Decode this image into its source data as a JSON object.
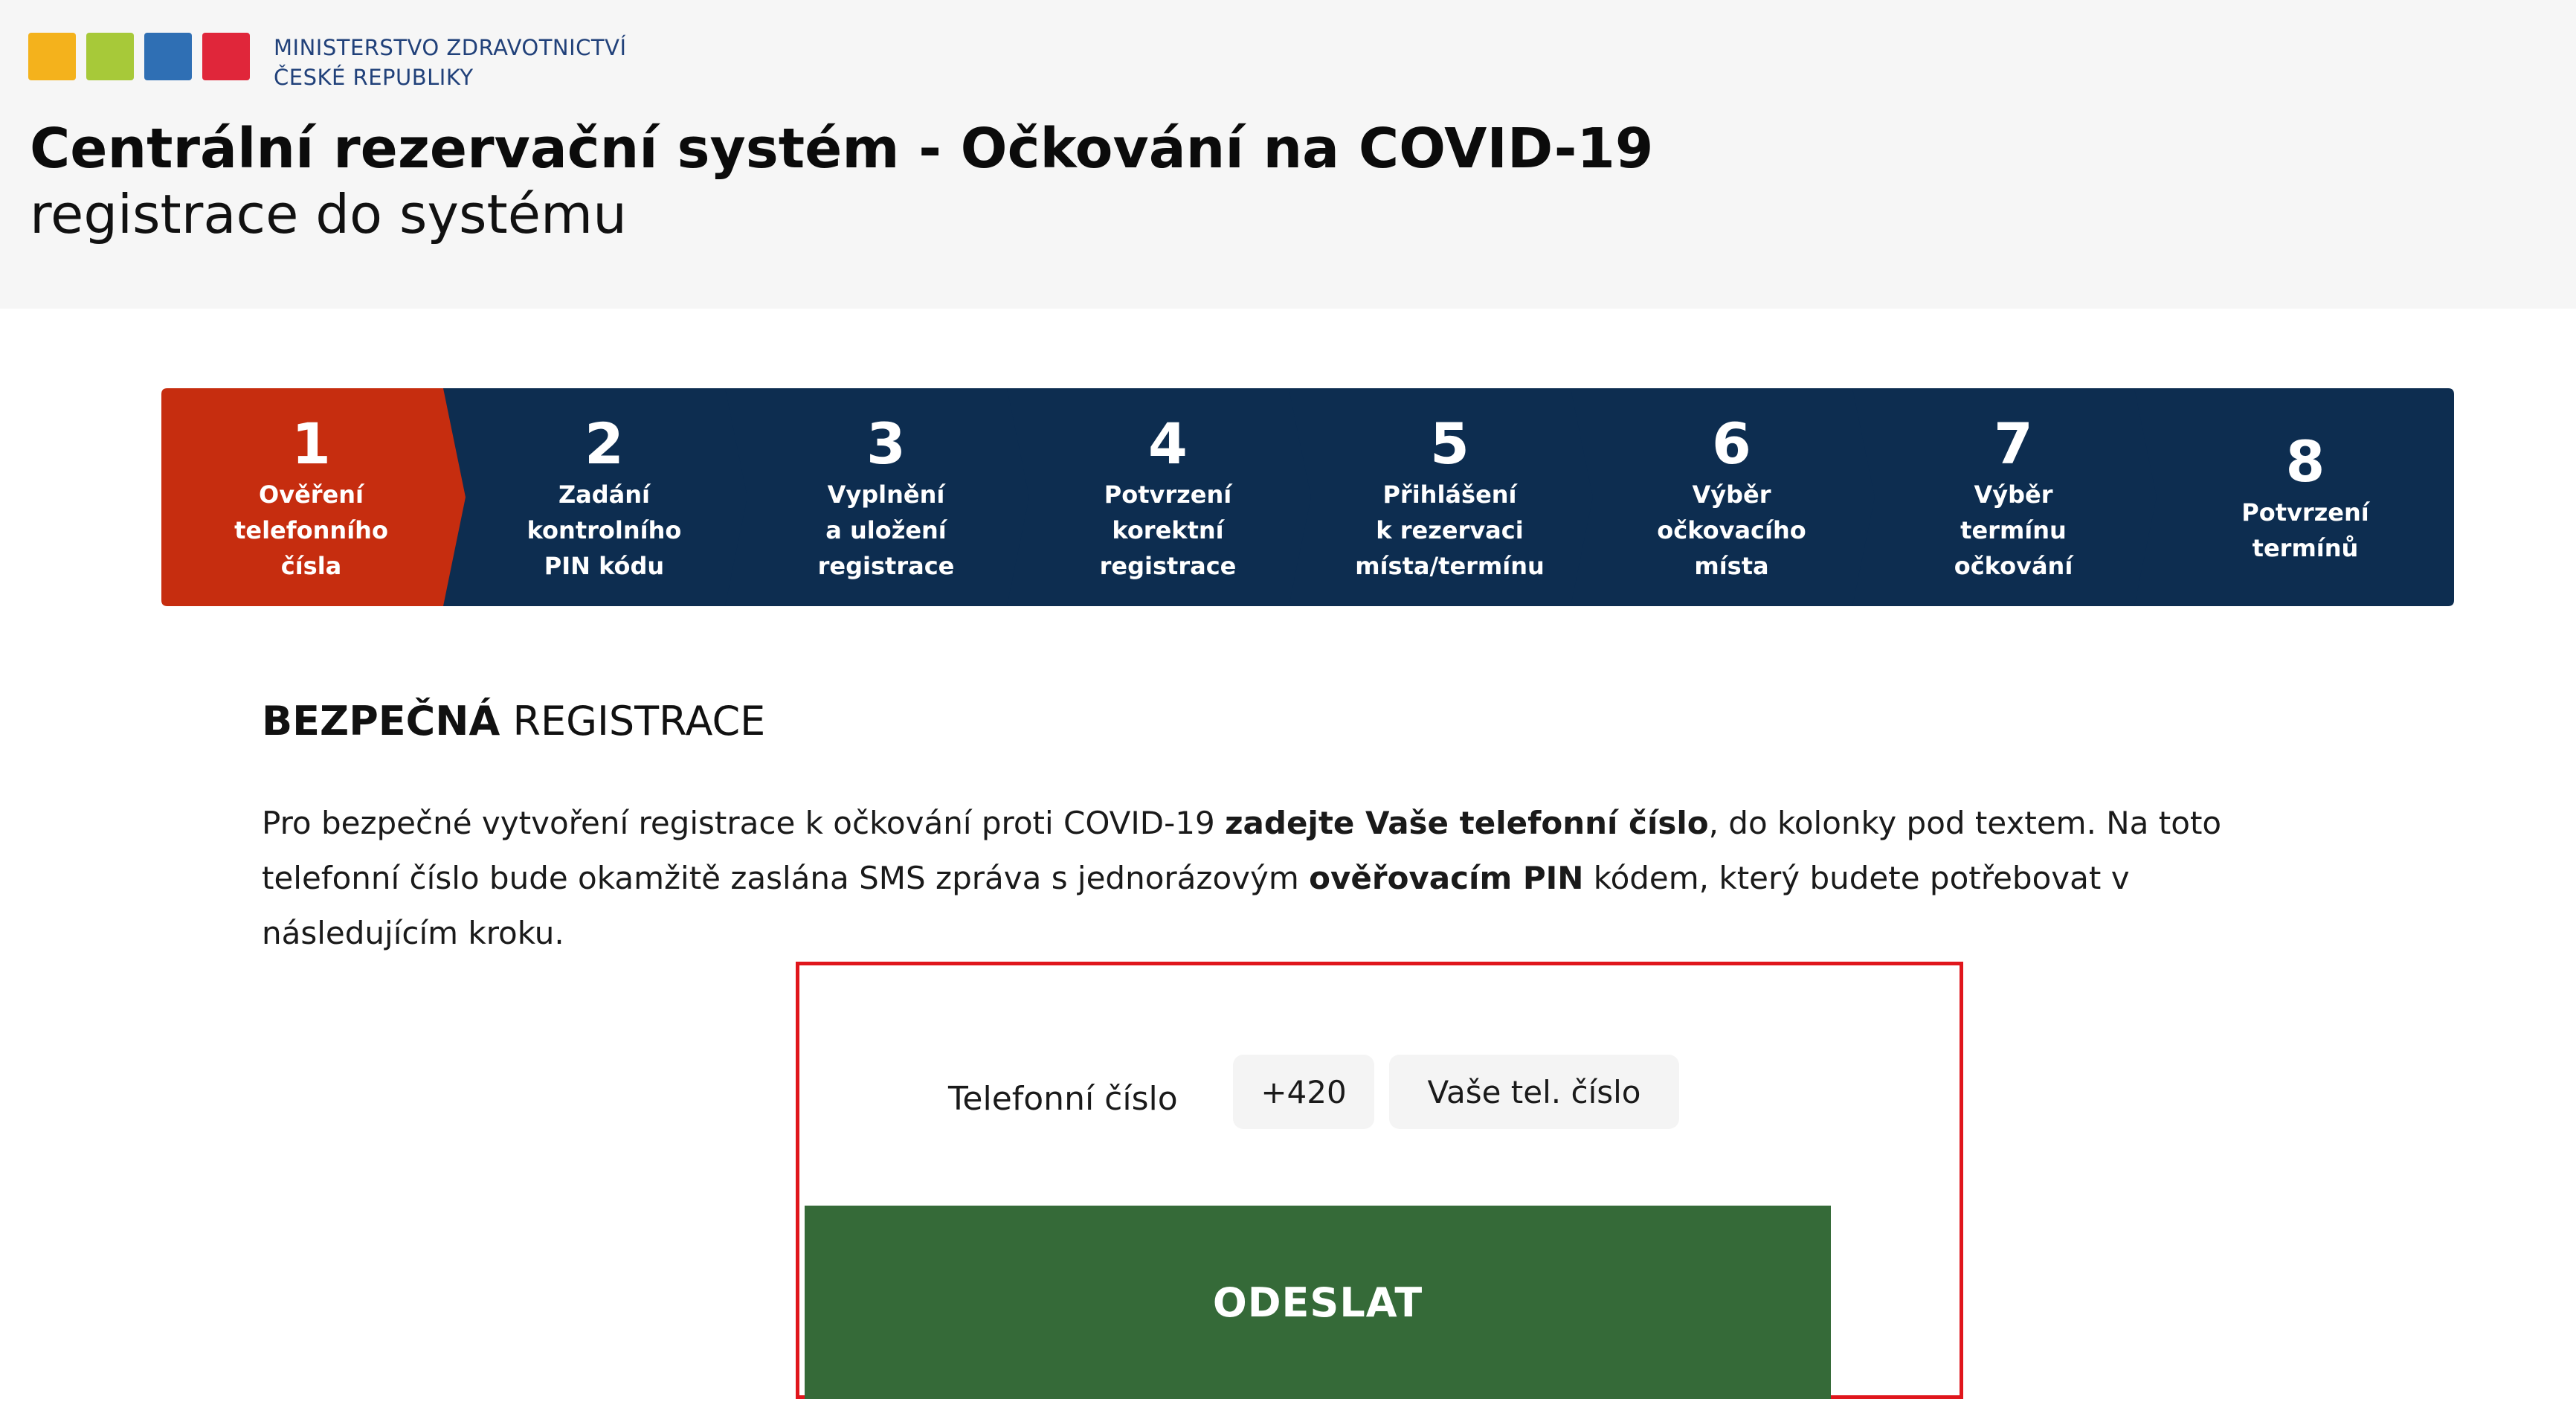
{
  "header": {
    "ministry_line1": "MINISTERSTVO ZDRAVOTNICTVÍ",
    "ministry_line2": "ČESKÉ REPUBLIKY",
    "title": "Centrální rezervační systém - Očkování na COVID-19",
    "subtitle": "registrace do systému"
  },
  "logo": {
    "tile_colors": [
      "#f4b21c",
      "#a7c939",
      "#2f6fb4",
      "#e0263a"
    ]
  },
  "stepper": {
    "active_color": "#c62d0f",
    "inactive_color": "#0d2d50",
    "active_step": 1,
    "steps": [
      {
        "num": "1",
        "label": "Ověření\ntelefonního\nčísla"
      },
      {
        "num": "2",
        "label": "Zadání\nkontrolního\nPIN kódu"
      },
      {
        "num": "3",
        "label": "Vyplnění\na uložení\nregistrace"
      },
      {
        "num": "4",
        "label": "Potvrzení\nkorektní\nregistrace"
      },
      {
        "num": "5",
        "label": "Přihlášení\nk rezervaci\nmísta/termínu"
      },
      {
        "num": "6",
        "label": "Výběr\nočkovacího\nmísta"
      },
      {
        "num": "7",
        "label": "Výběr\ntermínu\nočkování"
      },
      {
        "num": "8",
        "label": "Potvrzení\ntermínů"
      }
    ]
  },
  "section": {
    "title_bold": "BEZPEČNÁ",
    "title_rest": " REGISTRACE"
  },
  "intro": {
    "part1": "Pro bezpečné vytvoření registrace k očkování proti COVID-19 ",
    "bold1": "zadejte Vaše telefonní číslo",
    "part2": ", do kolonky pod textem. Na toto telefonní číslo bude okamžitě zaslána SMS zpráva s jednorázovým ",
    "bold2": "ověřovacím PIN",
    "part3": " kódem, který budete potřebovat v následujícím kroku."
  },
  "form": {
    "phone_label": "Telefonní číslo",
    "prefix": "+420",
    "phone_placeholder": "Vaše tel. číslo",
    "phone_value": "",
    "submit_label": "ODESLAT"
  }
}
